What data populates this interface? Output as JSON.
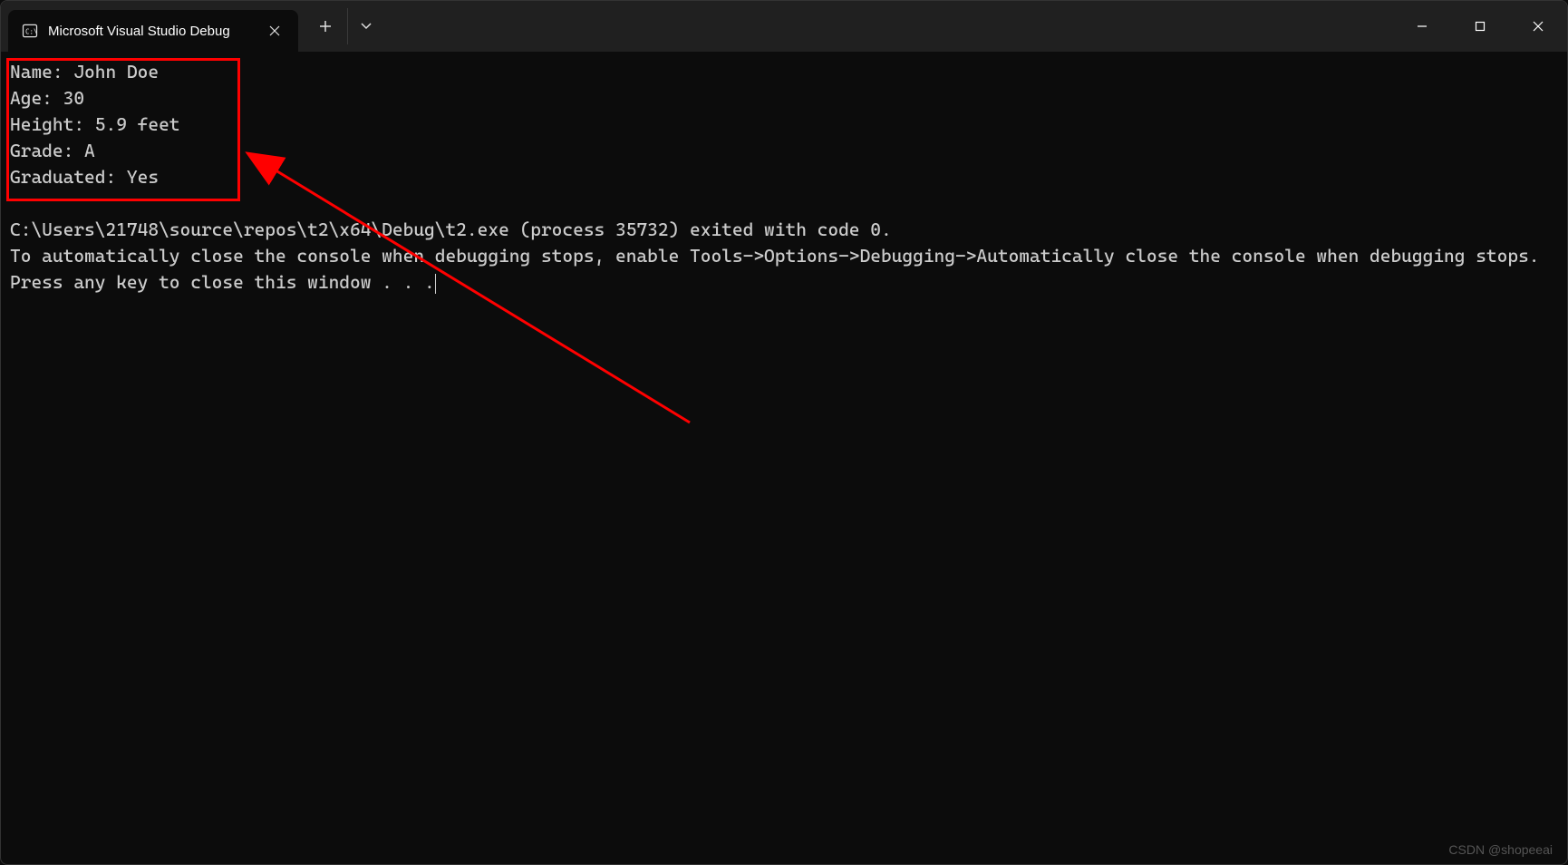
{
  "tab": {
    "title": "Microsoft Visual Studio Debug"
  },
  "output": {
    "line1": "Name: John Doe",
    "line2": "Age: 30",
    "line3": "Height: 5.9 feet",
    "line4": "Grade: A",
    "line5": "Graduated: Yes",
    "blank": "",
    "exit_msg": "C:\\Users\\21748\\source\\repos\\t2\\x64\\Debug\\t2.exe (process 35732) exited with code 0.",
    "auto_close_msg": "To automatically close the console when debugging stops, enable Tools->Options->Debugging->Automatically close the console when debugging stops.",
    "press_key_msg": "Press any key to close this window . . ."
  },
  "watermark": "CSDN @shopeeai"
}
